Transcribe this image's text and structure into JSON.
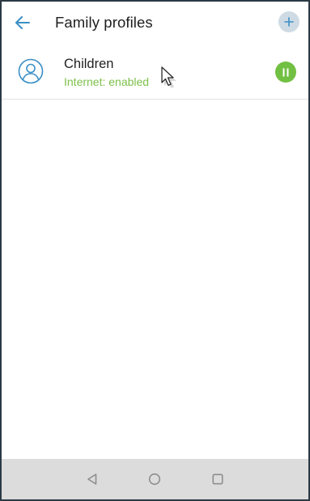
{
  "header": {
    "title": "Family profiles",
    "back_icon": "arrow-left-icon",
    "add_icon": "plus-icon"
  },
  "profiles": [
    {
      "name": "Children",
      "status": "Internet: enabled",
      "avatar_icon": "user-circle-icon",
      "action_icon": "pause-icon"
    }
  ],
  "navbar": {
    "back_icon": "triangle-back-icon",
    "home_icon": "circle-home-icon",
    "recents_icon": "square-recents-icon"
  },
  "colors": {
    "accent": "#3a8fc6",
    "status_green": "#7cc04a",
    "pause_green": "#72c043",
    "add_bg": "#cfdbe4",
    "navbar_bg": "#dcdcdc"
  }
}
